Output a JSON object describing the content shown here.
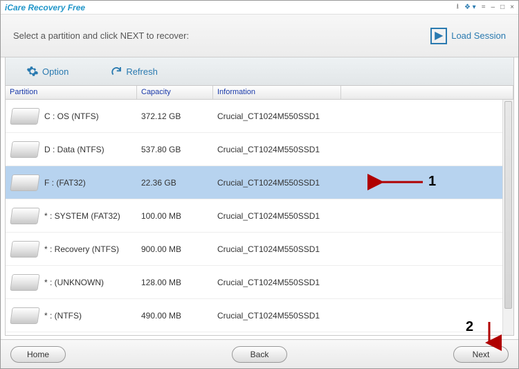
{
  "window": {
    "title": "iCare Recovery Free"
  },
  "header": {
    "instruction": "Select a partition and click NEXT to recover:",
    "load_session": "Load Session"
  },
  "toolbar": {
    "option": "Option",
    "refresh": "Refresh"
  },
  "table": {
    "headers": {
      "partition": "Partition",
      "capacity": "Capacity",
      "information": "Information"
    },
    "rows": [
      {
        "partition": "C : OS (NTFS)",
        "capacity": "372.12 GB",
        "info": "Crucial_CT1024M550SSD1",
        "selected": false
      },
      {
        "partition": "D : Data (NTFS)",
        "capacity": "537.80 GB",
        "info": "Crucial_CT1024M550SSD1",
        "selected": false
      },
      {
        "partition": "F :  (FAT32)",
        "capacity": "22.36 GB",
        "info": "Crucial_CT1024M550SSD1",
        "selected": true
      },
      {
        "partition": "* : SYSTEM (FAT32)",
        "capacity": "100.00 MB",
        "info": "Crucial_CT1024M550SSD1",
        "selected": false
      },
      {
        "partition": "* : Recovery (NTFS)",
        "capacity": "900.00 MB",
        "info": "Crucial_CT1024M550SSD1",
        "selected": false
      },
      {
        "partition": "* :  (UNKNOWN)",
        "capacity": "128.00 MB",
        "info": "Crucial_CT1024M550SSD1",
        "selected": false
      },
      {
        "partition": "* :  (NTFS)",
        "capacity": "490.00 MB",
        "info": "Crucial_CT1024M550SSD1",
        "selected": false
      }
    ]
  },
  "footer": {
    "home": "Home",
    "back": "Back",
    "next": "Next"
  },
  "annotations": {
    "one": "1",
    "two": "2"
  }
}
